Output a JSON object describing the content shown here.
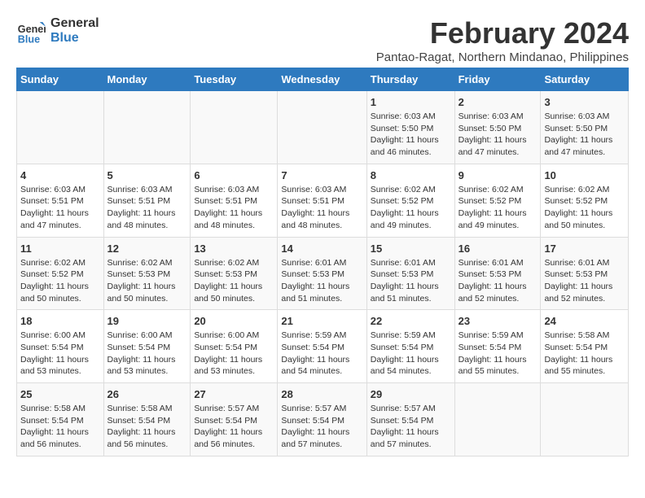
{
  "logo": {
    "line1": "General",
    "line2": "Blue"
  },
  "title": "February 2024",
  "location": "Pantao-Ragat, Northern Mindanao, Philippines",
  "weekdays": [
    "Sunday",
    "Monday",
    "Tuesday",
    "Wednesday",
    "Thursday",
    "Friday",
    "Saturday"
  ],
  "weeks": [
    [
      {
        "day": "",
        "info": ""
      },
      {
        "day": "",
        "info": ""
      },
      {
        "day": "",
        "info": ""
      },
      {
        "day": "",
        "info": ""
      },
      {
        "day": "1",
        "info": "Sunrise: 6:03 AM\nSunset: 5:50 PM\nDaylight: 11 hours\nand 46 minutes."
      },
      {
        "day": "2",
        "info": "Sunrise: 6:03 AM\nSunset: 5:50 PM\nDaylight: 11 hours\nand 47 minutes."
      },
      {
        "day": "3",
        "info": "Sunrise: 6:03 AM\nSunset: 5:50 PM\nDaylight: 11 hours\nand 47 minutes."
      }
    ],
    [
      {
        "day": "4",
        "info": "Sunrise: 6:03 AM\nSunset: 5:51 PM\nDaylight: 11 hours\nand 47 minutes."
      },
      {
        "day": "5",
        "info": "Sunrise: 6:03 AM\nSunset: 5:51 PM\nDaylight: 11 hours\nand 48 minutes."
      },
      {
        "day": "6",
        "info": "Sunrise: 6:03 AM\nSunset: 5:51 PM\nDaylight: 11 hours\nand 48 minutes."
      },
      {
        "day": "7",
        "info": "Sunrise: 6:03 AM\nSunset: 5:51 PM\nDaylight: 11 hours\nand 48 minutes."
      },
      {
        "day": "8",
        "info": "Sunrise: 6:02 AM\nSunset: 5:52 PM\nDaylight: 11 hours\nand 49 minutes."
      },
      {
        "day": "9",
        "info": "Sunrise: 6:02 AM\nSunset: 5:52 PM\nDaylight: 11 hours\nand 49 minutes."
      },
      {
        "day": "10",
        "info": "Sunrise: 6:02 AM\nSunset: 5:52 PM\nDaylight: 11 hours\nand 50 minutes."
      }
    ],
    [
      {
        "day": "11",
        "info": "Sunrise: 6:02 AM\nSunset: 5:52 PM\nDaylight: 11 hours\nand 50 minutes."
      },
      {
        "day": "12",
        "info": "Sunrise: 6:02 AM\nSunset: 5:53 PM\nDaylight: 11 hours\nand 50 minutes."
      },
      {
        "day": "13",
        "info": "Sunrise: 6:02 AM\nSunset: 5:53 PM\nDaylight: 11 hours\nand 50 minutes."
      },
      {
        "day": "14",
        "info": "Sunrise: 6:01 AM\nSunset: 5:53 PM\nDaylight: 11 hours\nand 51 minutes."
      },
      {
        "day": "15",
        "info": "Sunrise: 6:01 AM\nSunset: 5:53 PM\nDaylight: 11 hours\nand 51 minutes."
      },
      {
        "day": "16",
        "info": "Sunrise: 6:01 AM\nSunset: 5:53 PM\nDaylight: 11 hours\nand 52 minutes."
      },
      {
        "day": "17",
        "info": "Sunrise: 6:01 AM\nSunset: 5:53 PM\nDaylight: 11 hours\nand 52 minutes."
      }
    ],
    [
      {
        "day": "18",
        "info": "Sunrise: 6:00 AM\nSunset: 5:54 PM\nDaylight: 11 hours\nand 53 minutes."
      },
      {
        "day": "19",
        "info": "Sunrise: 6:00 AM\nSunset: 5:54 PM\nDaylight: 11 hours\nand 53 minutes."
      },
      {
        "day": "20",
        "info": "Sunrise: 6:00 AM\nSunset: 5:54 PM\nDaylight: 11 hours\nand 53 minutes."
      },
      {
        "day": "21",
        "info": "Sunrise: 5:59 AM\nSunset: 5:54 PM\nDaylight: 11 hours\nand 54 minutes."
      },
      {
        "day": "22",
        "info": "Sunrise: 5:59 AM\nSunset: 5:54 PM\nDaylight: 11 hours\nand 54 minutes."
      },
      {
        "day": "23",
        "info": "Sunrise: 5:59 AM\nSunset: 5:54 PM\nDaylight: 11 hours\nand 55 minutes."
      },
      {
        "day": "24",
        "info": "Sunrise: 5:58 AM\nSunset: 5:54 PM\nDaylight: 11 hours\nand 55 minutes."
      }
    ],
    [
      {
        "day": "25",
        "info": "Sunrise: 5:58 AM\nSunset: 5:54 PM\nDaylight: 11 hours\nand 56 minutes."
      },
      {
        "day": "26",
        "info": "Sunrise: 5:58 AM\nSunset: 5:54 PM\nDaylight: 11 hours\nand 56 minutes."
      },
      {
        "day": "27",
        "info": "Sunrise: 5:57 AM\nSunset: 5:54 PM\nDaylight: 11 hours\nand 56 minutes."
      },
      {
        "day": "28",
        "info": "Sunrise: 5:57 AM\nSunset: 5:54 PM\nDaylight: 11 hours\nand 57 minutes."
      },
      {
        "day": "29",
        "info": "Sunrise: 5:57 AM\nSunset: 5:54 PM\nDaylight: 11 hours\nand 57 minutes."
      },
      {
        "day": "",
        "info": ""
      },
      {
        "day": "",
        "info": ""
      }
    ]
  ]
}
